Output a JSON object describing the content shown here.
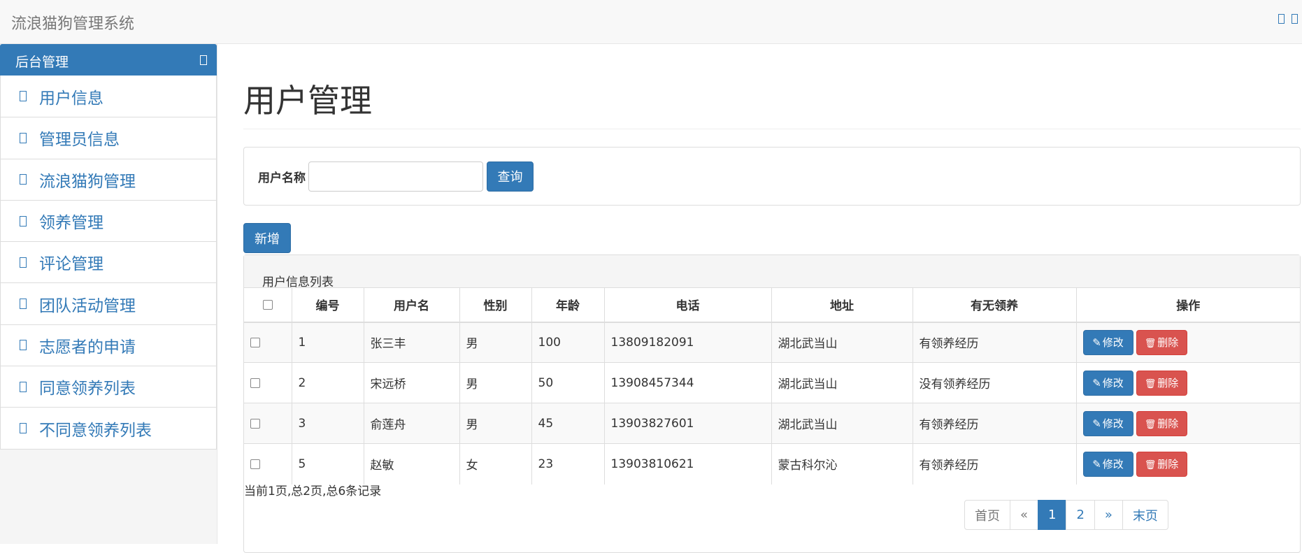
{
  "app": {
    "brand": "流浪猫狗管理系统"
  },
  "sidebar": {
    "header": "后台管理",
    "items": [
      {
        "label": "用户信息"
      },
      {
        "label": "管理员信息"
      },
      {
        "label": "流浪猫狗管理"
      },
      {
        "label": "领养管理"
      },
      {
        "label": "评论管理"
      },
      {
        "label": "团队活动管理"
      },
      {
        "label": "志愿者的申请"
      },
      {
        "label": "同意领养列表"
      },
      {
        "label": "不同意领养列表"
      }
    ]
  },
  "main": {
    "title": "用户管理",
    "search": {
      "label": "用户名称",
      "value": "",
      "query_label": "查询"
    },
    "add_label": "新增",
    "list_title": "用户信息列表",
    "columns": [
      "编号",
      "用户名",
      "性别",
      "年龄",
      "电话",
      "地址",
      "有无领养",
      "操作"
    ],
    "rows": [
      {
        "id": "1",
        "username": "张三丰",
        "gender": "男",
        "age": "100",
        "phone": "13809182091",
        "address": "湖北武当山",
        "adopted": "有领养经历"
      },
      {
        "id": "2",
        "username": "宋远桥",
        "gender": "男",
        "age": "50",
        "phone": "13908457344",
        "address": "湖北武当山",
        "adopted": "没有领养经历"
      },
      {
        "id": "3",
        "username": "俞莲舟",
        "gender": "男",
        "age": "45",
        "phone": "13903827601",
        "address": "湖北武当山",
        "adopted": "有领养经历"
      },
      {
        "id": "5",
        "username": "赵敏",
        "gender": "女",
        "age": "23",
        "phone": "13903810621",
        "address": "蒙古科尔沁",
        "adopted": "有领养经历"
      }
    ],
    "edit_label": "修改",
    "delete_label": "删除",
    "record_info": "当前1页,总2页,总6条记录",
    "pagination": {
      "first": "首页",
      "prev": "«",
      "pages": [
        "1",
        "2"
      ],
      "next": "»",
      "last": "末页",
      "current": "1"
    }
  }
}
